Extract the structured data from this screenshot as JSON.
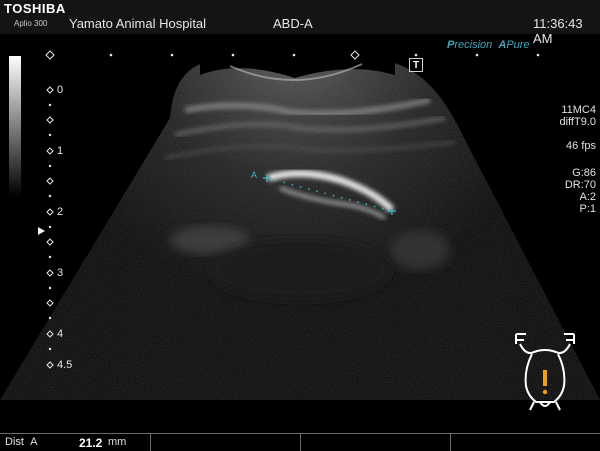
{
  "header": {
    "brand": "TOSHIBA",
    "model": "Aplio 300",
    "hospital": "Yamato Animal Hospital",
    "exam": "ABD-A",
    "time": "11:36:43 AM"
  },
  "image_mode": {
    "precision_prefix": "P",
    "precision_rest": "recision",
    "pure_prefix": "A",
    "pure_rest": "Pure",
    "marker": "T"
  },
  "depth_scale": {
    "labels": [
      "0",
      "1",
      "2",
      "3",
      "4",
      "4.5"
    ],
    "unit": "cm"
  },
  "parameters": {
    "probe": "11MC4",
    "mode": "diffT9.0",
    "fps": "46 fps",
    "gain": "G:86",
    "dynamic_range": "DR:70",
    "a_value": "A:2",
    "p_value": "P:1"
  },
  "measurement": {
    "caliper_label": "A",
    "name": "Dist",
    "label": "A",
    "value": "21.2",
    "unit": "mm"
  },
  "colors": {
    "caliper": "#3fb8c2",
    "pictogram_accent": "#f0a010",
    "header_bg": "#121416"
  }
}
